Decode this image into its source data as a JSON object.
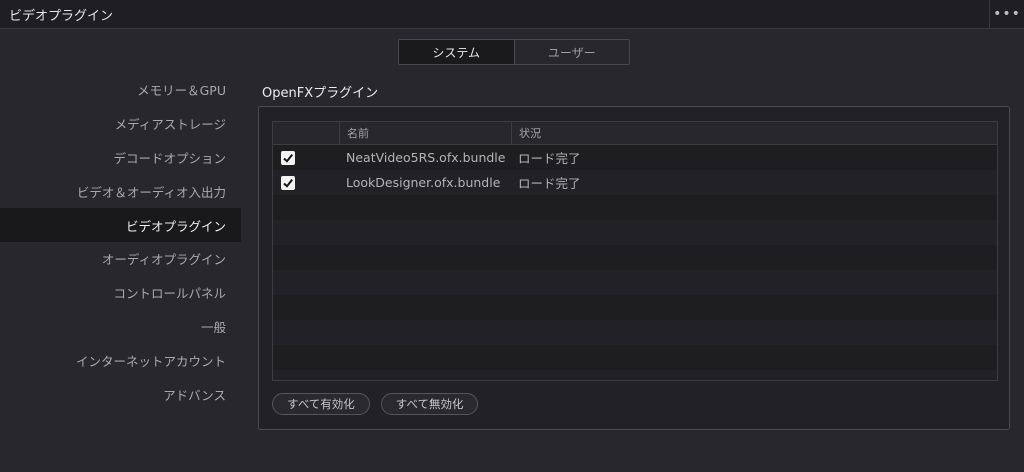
{
  "window": {
    "title": "ビデオプラグイン",
    "menu_icon": "ellipsis-icon"
  },
  "tabs": [
    {
      "label": "システム",
      "active": true
    },
    {
      "label": "ユーザー",
      "active": false
    }
  ],
  "sidebar": {
    "items": [
      {
        "label": "メモリー＆GPU"
      },
      {
        "label": "メディアストレージ"
      },
      {
        "label": "デコードオプション"
      },
      {
        "label": "ビデオ＆オーディオ入出力"
      },
      {
        "label": "ビデオプラグイン",
        "active": true
      },
      {
        "label": "オーディオプラグイン"
      },
      {
        "label": "コントロールパネル"
      },
      {
        "label": "一般"
      },
      {
        "label": "インターネットアカウント"
      },
      {
        "label": "アドバンス"
      }
    ]
  },
  "main": {
    "section_title": "OpenFXプラグイン",
    "table": {
      "columns": [
        "",
        "名前",
        "状況"
      ],
      "rows": [
        {
          "checked": true,
          "name": "NeatVideo5RS.ofx.bundle",
          "status": "ロード完了"
        },
        {
          "checked": true,
          "name": "LookDesigner.ofx.bundle",
          "status": "ロード完了"
        }
      ],
      "empty_row_count": 8
    },
    "buttons": {
      "enable_all": "すべて有効化",
      "disable_all": "すべて無効化"
    }
  },
  "colors": {
    "background": "#28272b",
    "titlebar": "#1f1e22",
    "active_sidebar": "#19191c",
    "checkbox": "#f2f2f2"
  }
}
